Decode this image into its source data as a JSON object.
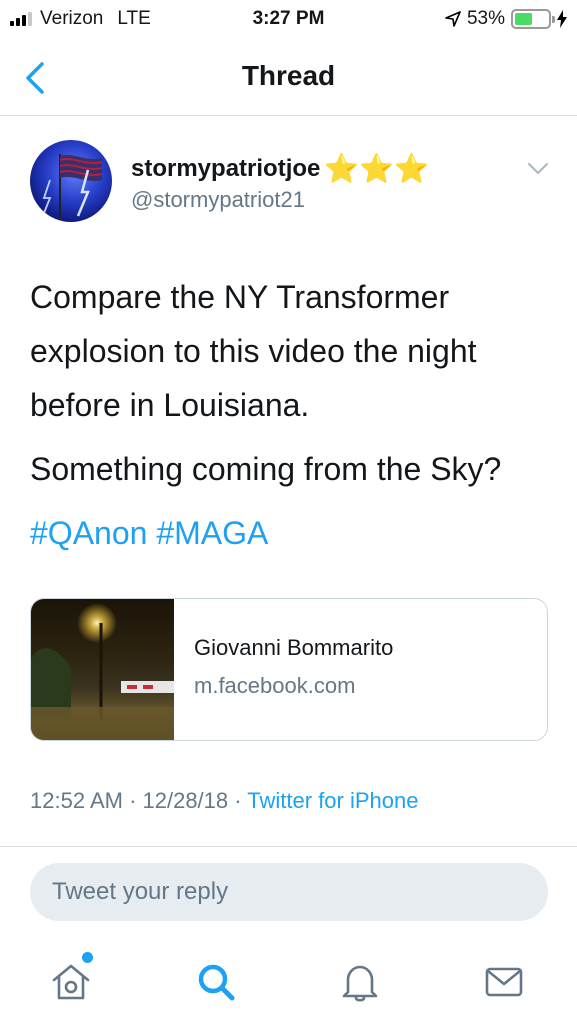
{
  "status_bar": {
    "carrier": "Verizon",
    "network": "LTE",
    "time": "3:27 PM",
    "battery_percent": "53%",
    "battery_level": 0.53,
    "icons": [
      "signal-icon",
      "location-arrow-icon",
      "battery-icon",
      "charging-bolt-icon"
    ]
  },
  "nav": {
    "title": "Thread",
    "back_icon": "chevron-left-icon"
  },
  "tweet": {
    "display_name": "stormypatriotjoe",
    "name_emoji": "⭐⭐⭐",
    "handle": "@stormypatriot21",
    "text_line_1": "Compare the NY Transformer explosion to this video the night before in Louisiana.",
    "text_line_2": "Something coming from the Sky?",
    "hashtag_1": "#QAnon",
    "hashtag_2": "#MAGA",
    "card": {
      "title": "Giovanni Bommarito",
      "domain": "m.facebook.com"
    },
    "timestamp": "12:52 AM · 12/28/18 · ",
    "source": "Twitter for iPhone"
  },
  "reply": {
    "placeholder": "Tweet your reply"
  },
  "tab_bar": {
    "items": [
      "home-icon",
      "search-icon",
      "notifications-bell-icon",
      "messages-envelope-icon"
    ]
  },
  "colors": {
    "accent": "#1da1f2",
    "secondary_text": "#657786",
    "primary_text": "#14171a",
    "battery": "#4cd964"
  }
}
